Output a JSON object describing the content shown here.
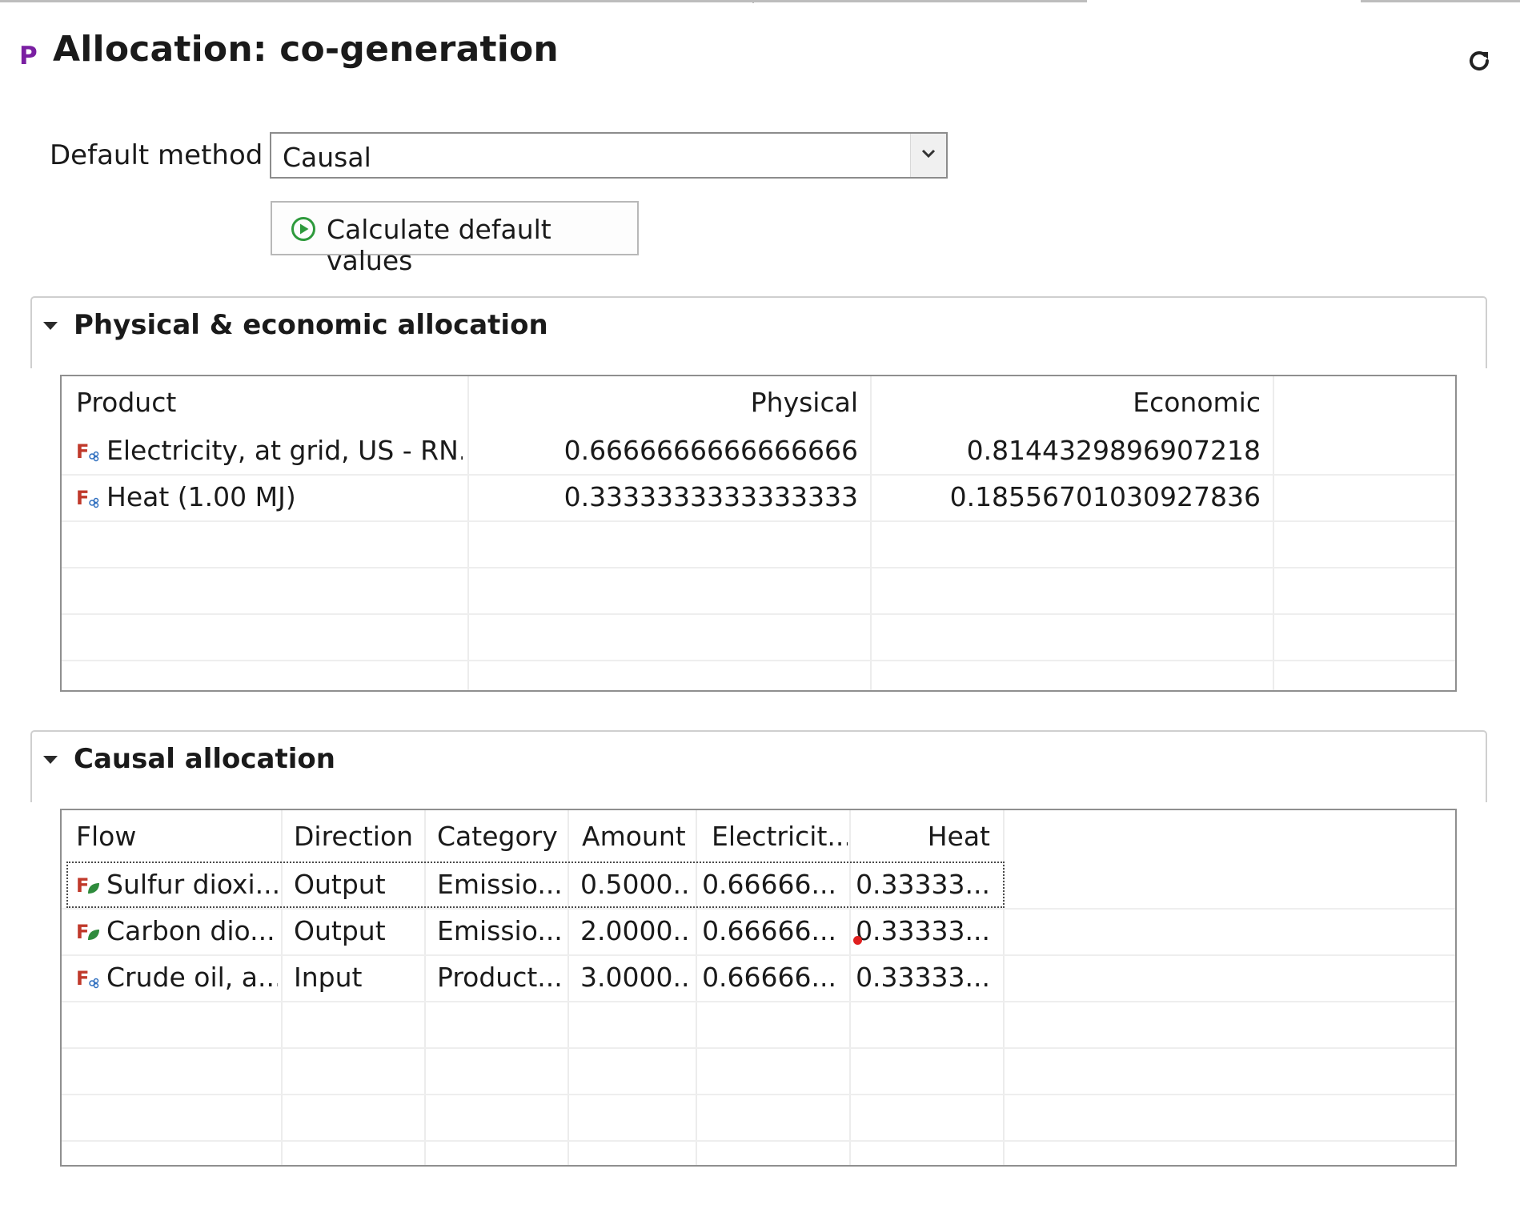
{
  "header": {
    "type_letter": "P",
    "title": "Allocation: co-generation",
    "refresh_icon": "refresh-icon"
  },
  "method": {
    "label": "Default method",
    "selected": "Causal",
    "calc_button": "Calculate default values"
  },
  "physical": {
    "title": "Physical & economic allocation",
    "columns": [
      "Product",
      "Physical",
      "Economic"
    ],
    "rows": [
      {
        "product": "Electricity, at grid, US - RN...",
        "physical": "0.6666666666666666",
        "economic": "0.8144329896907218"
      },
      {
        "product": "Heat (1.00 MJ)",
        "physical": "0.3333333333333333",
        "economic": "0.18556701030927836"
      }
    ]
  },
  "causal": {
    "title": "Causal allocation",
    "columns": [
      "Flow",
      "Direction",
      "Category",
      "Amount",
      "Electricit...",
      "Heat"
    ],
    "rows": [
      {
        "flow": "Sulfur dioxi...",
        "direction": "Output",
        "category": "Emissio...",
        "amount": "0.5000...",
        "electricity": "0.66666...",
        "heat": "0.33333...",
        "icon": "elementary-flow-icon"
      },
      {
        "flow": "Carbon dio...",
        "direction": "Output",
        "category": "Emissio...",
        "amount": "2.0000...",
        "electricity": "0.66666...",
        "heat": "0.33333...",
        "icon": "elementary-flow-icon"
      },
      {
        "flow": "Crude oil, a...",
        "direction": "Input",
        "category": "Product...",
        "amount": "3.0000...",
        "electricity": "0.66666...",
        "heat": "0.33333...",
        "icon": "product-flow-icon"
      }
    ]
  },
  "colors": {
    "accent_purple": "#7a1fa2",
    "play_green": "#2e9a3c",
    "flow_icon_red": "#c0392b",
    "grid_border": "#8f8f8f"
  }
}
